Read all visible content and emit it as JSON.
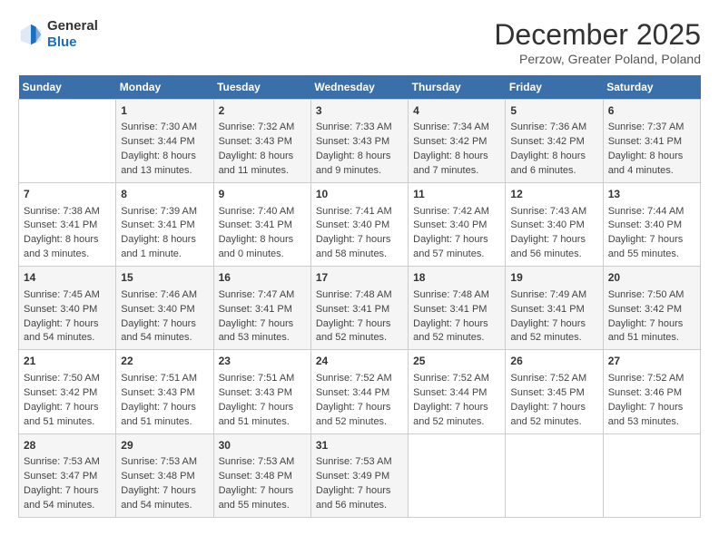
{
  "header": {
    "logo_general": "General",
    "logo_blue": "Blue",
    "title": "December 2025",
    "subtitle": "Perzow, Greater Poland, Poland"
  },
  "days_of_week": [
    "Sunday",
    "Monday",
    "Tuesday",
    "Wednesday",
    "Thursday",
    "Friday",
    "Saturday"
  ],
  "weeks": [
    [
      {
        "day": "",
        "info": ""
      },
      {
        "day": "1",
        "info": "Sunrise: 7:30 AM\nSunset: 3:44 PM\nDaylight: 8 hours\nand 13 minutes."
      },
      {
        "day": "2",
        "info": "Sunrise: 7:32 AM\nSunset: 3:43 PM\nDaylight: 8 hours\nand 11 minutes."
      },
      {
        "day": "3",
        "info": "Sunrise: 7:33 AM\nSunset: 3:43 PM\nDaylight: 8 hours\nand 9 minutes."
      },
      {
        "day": "4",
        "info": "Sunrise: 7:34 AM\nSunset: 3:42 PM\nDaylight: 8 hours\nand 7 minutes."
      },
      {
        "day": "5",
        "info": "Sunrise: 7:36 AM\nSunset: 3:42 PM\nDaylight: 8 hours\nand 6 minutes."
      },
      {
        "day": "6",
        "info": "Sunrise: 7:37 AM\nSunset: 3:41 PM\nDaylight: 8 hours\nand 4 minutes."
      }
    ],
    [
      {
        "day": "7",
        "info": "Sunrise: 7:38 AM\nSunset: 3:41 PM\nDaylight: 8 hours\nand 3 minutes."
      },
      {
        "day": "8",
        "info": "Sunrise: 7:39 AM\nSunset: 3:41 PM\nDaylight: 8 hours\nand 1 minute."
      },
      {
        "day": "9",
        "info": "Sunrise: 7:40 AM\nSunset: 3:41 PM\nDaylight: 8 hours\nand 0 minutes."
      },
      {
        "day": "10",
        "info": "Sunrise: 7:41 AM\nSunset: 3:40 PM\nDaylight: 7 hours\nand 58 minutes."
      },
      {
        "day": "11",
        "info": "Sunrise: 7:42 AM\nSunset: 3:40 PM\nDaylight: 7 hours\nand 57 minutes."
      },
      {
        "day": "12",
        "info": "Sunrise: 7:43 AM\nSunset: 3:40 PM\nDaylight: 7 hours\nand 56 minutes."
      },
      {
        "day": "13",
        "info": "Sunrise: 7:44 AM\nSunset: 3:40 PM\nDaylight: 7 hours\nand 55 minutes."
      }
    ],
    [
      {
        "day": "14",
        "info": "Sunrise: 7:45 AM\nSunset: 3:40 PM\nDaylight: 7 hours\nand 54 minutes."
      },
      {
        "day": "15",
        "info": "Sunrise: 7:46 AM\nSunset: 3:40 PM\nDaylight: 7 hours\nand 54 minutes."
      },
      {
        "day": "16",
        "info": "Sunrise: 7:47 AM\nSunset: 3:41 PM\nDaylight: 7 hours\nand 53 minutes."
      },
      {
        "day": "17",
        "info": "Sunrise: 7:48 AM\nSunset: 3:41 PM\nDaylight: 7 hours\nand 52 minutes."
      },
      {
        "day": "18",
        "info": "Sunrise: 7:48 AM\nSunset: 3:41 PM\nDaylight: 7 hours\nand 52 minutes."
      },
      {
        "day": "19",
        "info": "Sunrise: 7:49 AM\nSunset: 3:41 PM\nDaylight: 7 hours\nand 52 minutes."
      },
      {
        "day": "20",
        "info": "Sunrise: 7:50 AM\nSunset: 3:42 PM\nDaylight: 7 hours\nand 51 minutes."
      }
    ],
    [
      {
        "day": "21",
        "info": "Sunrise: 7:50 AM\nSunset: 3:42 PM\nDaylight: 7 hours\nand 51 minutes."
      },
      {
        "day": "22",
        "info": "Sunrise: 7:51 AM\nSunset: 3:43 PM\nDaylight: 7 hours\nand 51 minutes."
      },
      {
        "day": "23",
        "info": "Sunrise: 7:51 AM\nSunset: 3:43 PM\nDaylight: 7 hours\nand 51 minutes."
      },
      {
        "day": "24",
        "info": "Sunrise: 7:52 AM\nSunset: 3:44 PM\nDaylight: 7 hours\nand 52 minutes."
      },
      {
        "day": "25",
        "info": "Sunrise: 7:52 AM\nSunset: 3:44 PM\nDaylight: 7 hours\nand 52 minutes."
      },
      {
        "day": "26",
        "info": "Sunrise: 7:52 AM\nSunset: 3:45 PM\nDaylight: 7 hours\nand 52 minutes."
      },
      {
        "day": "27",
        "info": "Sunrise: 7:52 AM\nSunset: 3:46 PM\nDaylight: 7 hours\nand 53 minutes."
      }
    ],
    [
      {
        "day": "28",
        "info": "Sunrise: 7:53 AM\nSunset: 3:47 PM\nDaylight: 7 hours\nand 54 minutes."
      },
      {
        "day": "29",
        "info": "Sunrise: 7:53 AM\nSunset: 3:48 PM\nDaylight: 7 hours\nand 54 minutes."
      },
      {
        "day": "30",
        "info": "Sunrise: 7:53 AM\nSunset: 3:48 PM\nDaylight: 7 hours\nand 55 minutes."
      },
      {
        "day": "31",
        "info": "Sunrise: 7:53 AM\nSunset: 3:49 PM\nDaylight: 7 hours\nand 56 minutes."
      },
      {
        "day": "",
        "info": ""
      },
      {
        "day": "",
        "info": ""
      },
      {
        "day": "",
        "info": ""
      }
    ]
  ]
}
